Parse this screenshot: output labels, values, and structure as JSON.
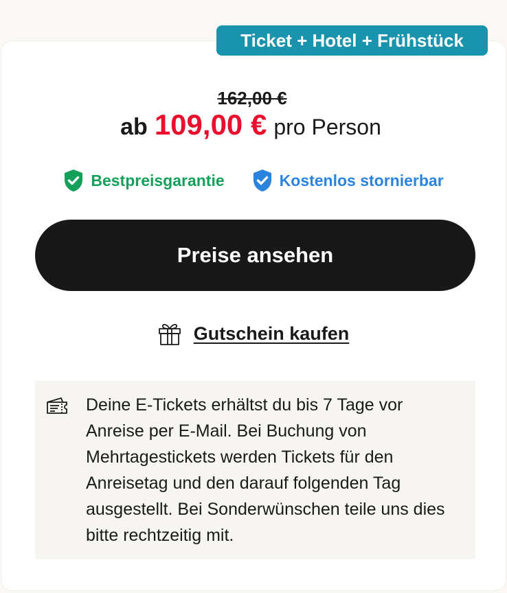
{
  "badge": {
    "label": "Ticket + Hotel + Frühstück"
  },
  "price": {
    "old": "162,00 €",
    "prefix": "ab",
    "current": "109,00 €",
    "unit": "pro Person"
  },
  "guarantees": [
    {
      "label": "Bestpreisgarantie",
      "color": "#14a05a",
      "icon": "shield-check-icon"
    },
    {
      "label": "Kostenlos stornierbar",
      "color": "#2a83dd",
      "icon": "shield-check-icon"
    }
  ],
  "cta": {
    "label": "Preise ansehen"
  },
  "voucher": {
    "label": "Gutschein kaufen",
    "icon": "gift-icon"
  },
  "info": {
    "icon": "ticket-icon",
    "text": "Deine E-Tickets erhältst du bis 7 Tage vor Anreise per E-Mail. Bei Buchung von Mehrtagestickets werden Tickets für den Anreisetag und den darauf folgenden Tag ausgestellt. Bei Sonderwünschen teile uns dies bitte rechtzeitig mit."
  },
  "colors": {
    "accent_price": "#e8112d",
    "badge_bg": "#1a93ad",
    "cta_bg": "#181818"
  }
}
